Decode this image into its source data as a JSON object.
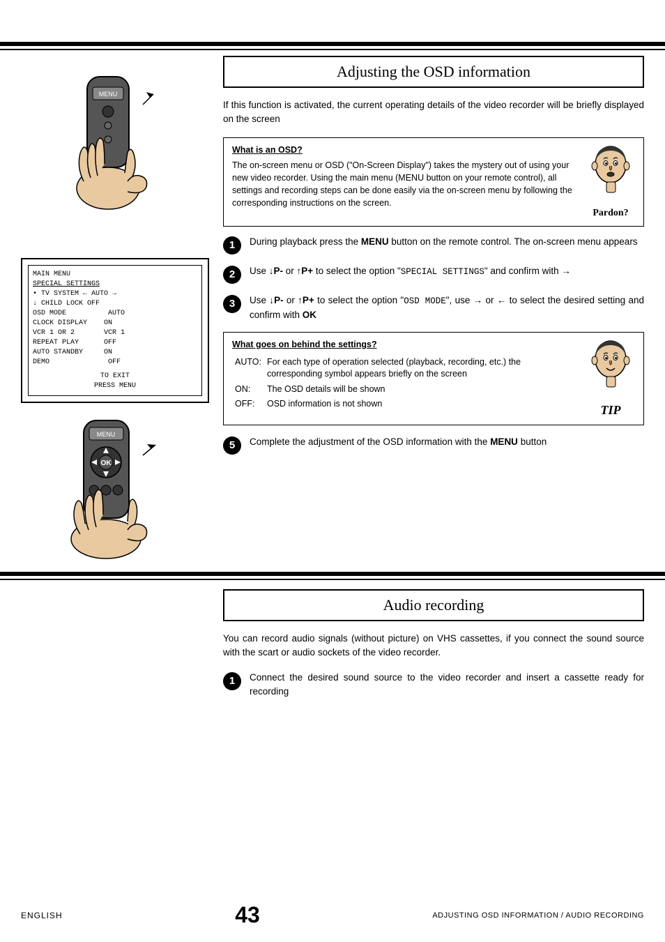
{
  "page": {
    "top_border": true
  },
  "section1": {
    "title": "Adjusting the OSD information",
    "intro_text": "If this function is activated, the current operating details of the video recorder will be briefly displayed on the screen",
    "info_box": {
      "title": "What is an OSD?",
      "text": "The on-screen menu or OSD (\"On-Screen Display\") takes the mystery out of using your new video recorder. Using the main menu (MENU button on your remote control), all settings and recording steps can be done easily via the on-screen menu by following the corresponding instructions on the screen.",
      "figure_label": "Pardon?"
    },
    "steps": [
      {
        "number": "1",
        "text_parts": [
          {
            "type": "normal",
            "text": "During playback press the "
          },
          {
            "type": "bold",
            "text": "MENU"
          },
          {
            "type": "normal",
            "text": " button on the remote control. The on-screen menu appears"
          }
        ]
      },
      {
        "number": "2",
        "text_parts": [
          {
            "type": "normal",
            "text": "Use ↓"
          },
          {
            "type": "bold",
            "text": "P-"
          },
          {
            "type": "normal",
            "text": " or ↑"
          },
          {
            "type": "bold",
            "text": "P+"
          },
          {
            "type": "normal",
            "text": " to select the option \""
          },
          {
            "type": "mono",
            "text": "SPECIAL SETTINGS"
          },
          {
            "type": "normal",
            "text": "\" and confirm with →"
          }
        ]
      },
      {
        "number": "3",
        "text_parts": [
          {
            "type": "normal",
            "text": "Use ↓"
          },
          {
            "type": "bold",
            "text": "P-"
          },
          {
            "type": "normal",
            "text": " or ↑"
          },
          {
            "type": "bold",
            "text": "P+"
          },
          {
            "type": "normal",
            "text": " to select the option \""
          },
          {
            "type": "mono",
            "text": "OSD MODE"
          },
          {
            "type": "normal",
            "text": "\", use → or ← to select the desired setting and confirm with "
          },
          {
            "type": "bold",
            "text": "OK"
          }
        ]
      }
    ],
    "tip_box": {
      "title": "What goes on behind the settings?",
      "rows": [
        {
          "label": "AUTO:",
          "text": "For each type of operation selected (playback, recording, etc.) the corresponding symbol appears briefly on the screen"
        },
        {
          "label": "ON:",
          "text": "The OSD details will be shown"
        },
        {
          "label": "OFF:",
          "text": "OSD information is not shown"
        }
      ],
      "figure_label": "TIP"
    },
    "step5": {
      "number": "5",
      "text_parts": [
        {
          "type": "normal",
          "text": "Complete the adjustment of the OSD information with the "
        },
        {
          "type": "bold",
          "text": "MENU"
        },
        {
          "type": "normal",
          "text": " button"
        }
      ]
    }
  },
  "section2": {
    "title": "Audio recording",
    "intro_text": "You can record audio signals (without picture) on VHS cassettes, if you connect the sound source with the scart or audio sockets of the video recorder.",
    "step1": {
      "number": "1",
      "text_parts": [
        {
          "type": "normal",
          "text": "Connect the desired sound source to the video recorder and insert a cassette ready for recording"
        }
      ]
    }
  },
  "menu_screen": {
    "line1": "MAIN MENU",
    "line2": "SPECIAL SETTINGS",
    "bullet1": "• TV SYSTEM      ← AUTO →",
    "bullet2": "↓ CHILD LOCK        OFF",
    "items": [
      "  OSD MODE          AUTO",
      "  CLOCK DISPLAY     ON",
      "  VCR 1 OR 2        VCR 1",
      "  REPEAT PLAY       OFF",
      "  AUTO STANDBY      ON",
      "  DEMO              OFF"
    ],
    "footer1": "TO EXIT",
    "footer2": "PRESS MENU"
  },
  "footer": {
    "language": "English",
    "page_number": "43",
    "section_label": "Adjusting OSD information / Audio recording"
  }
}
